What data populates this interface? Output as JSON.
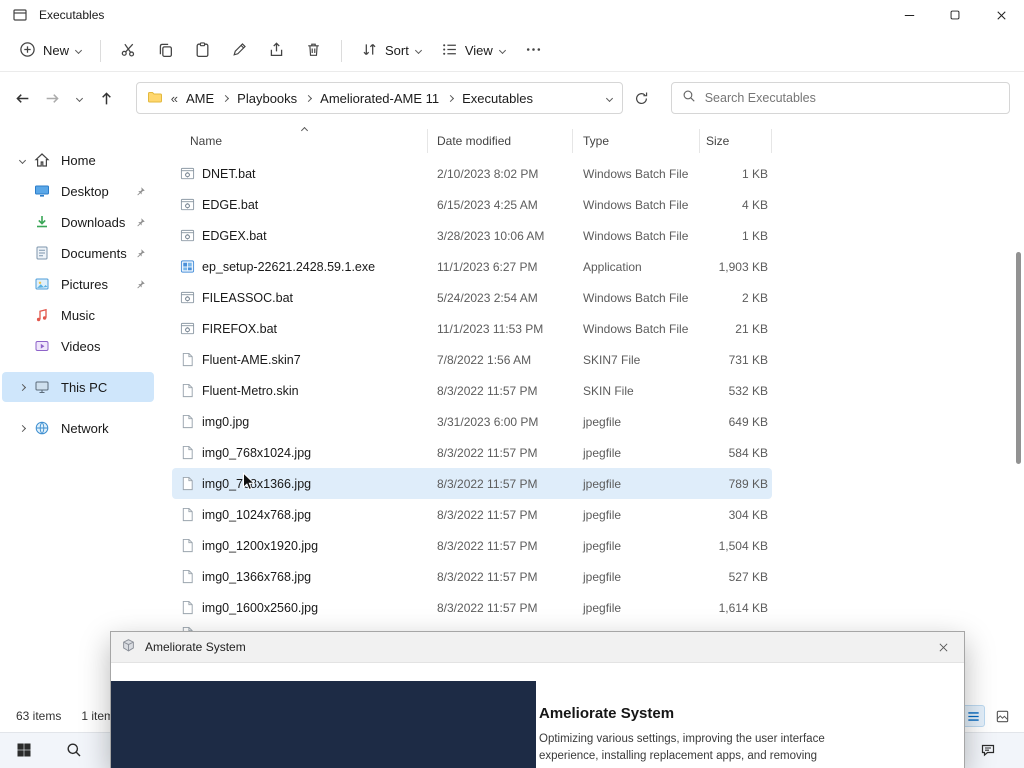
{
  "window": {
    "title": "Executables"
  },
  "toolbar": {
    "new": "New",
    "sort": "Sort",
    "view": "View"
  },
  "address": {
    "breadcrumb_prefix": "«",
    "crumbs": [
      "AME",
      "Playbooks",
      "Ameliorated-AME 11",
      "Executables"
    ],
    "search_placeholder": "Search Executables"
  },
  "sidebar": {
    "items": [
      {
        "label": "Home",
        "icon": "home-icon",
        "chevron": "down",
        "pinned": false,
        "selected": false,
        "gap_before": false
      },
      {
        "label": "Desktop",
        "icon": "desktop-icon",
        "chevron": null,
        "pinned": true,
        "selected": false,
        "gap_before": false
      },
      {
        "label": "Downloads",
        "icon": "downloads-icon",
        "chevron": null,
        "pinned": true,
        "selected": false,
        "gap_before": false
      },
      {
        "label": "Documents",
        "icon": "documents-icon",
        "chevron": null,
        "pinned": true,
        "selected": false,
        "gap_before": false
      },
      {
        "label": "Pictures",
        "icon": "pictures-icon",
        "chevron": null,
        "pinned": true,
        "selected": false,
        "gap_before": false
      },
      {
        "label": "Music",
        "icon": "music-icon",
        "chevron": null,
        "pinned": false,
        "selected": false,
        "gap_before": false
      },
      {
        "label": "Videos",
        "icon": "videos-icon",
        "chevron": null,
        "pinned": false,
        "selected": false,
        "gap_before": false
      },
      {
        "label": "This PC",
        "icon": "this-pc-icon",
        "chevron": "right",
        "pinned": false,
        "selected": true,
        "gap_before": true
      },
      {
        "label": "Network",
        "icon": "network-icon",
        "chevron": "right",
        "pinned": false,
        "selected": false,
        "gap_before": true
      }
    ]
  },
  "file_list": {
    "columns": [
      "Name",
      "Date modified",
      "Type",
      "Size"
    ],
    "sorted_column": "Name",
    "rows": [
      {
        "name": "DNET.bat",
        "date": "2/10/2023 8:02 PM",
        "type": "Windows Batch File",
        "size": "1 KB",
        "icon": "batch-file-icon",
        "hover": false
      },
      {
        "name": "EDGE.bat",
        "date": "6/15/2023 4:25 AM",
        "type": "Windows Batch File",
        "size": "4 KB",
        "icon": "batch-file-icon",
        "hover": false
      },
      {
        "name": "EDGEX.bat",
        "date": "3/28/2023 10:06 AM",
        "type": "Windows Batch File",
        "size": "1 KB",
        "icon": "batch-file-icon",
        "hover": false
      },
      {
        "name": "ep_setup-22621.2428.59.1.exe",
        "date": "11/1/2023 6:27 PM",
        "type": "Application",
        "size": "1,903 KB",
        "icon": "application-icon",
        "hover": false
      },
      {
        "name": "FILEASSOC.bat",
        "date": "5/24/2023 2:54 AM",
        "type": "Windows Batch File",
        "size": "2 KB",
        "icon": "batch-file-icon",
        "hover": false
      },
      {
        "name": "FIREFOX.bat",
        "date": "11/1/2023 11:53 PM",
        "type": "Windows Batch File",
        "size": "21 KB",
        "icon": "batch-file-icon",
        "hover": false
      },
      {
        "name": "Fluent-AME.skin7",
        "date": "7/8/2022 1:56 AM",
        "type": "SKIN7 File",
        "size": "731 KB",
        "icon": "file-icon",
        "hover": false
      },
      {
        "name": "Fluent-Metro.skin",
        "date": "8/3/2022 11:57 PM",
        "type": "SKIN File",
        "size": "532 KB",
        "icon": "file-icon",
        "hover": false
      },
      {
        "name": "img0.jpg",
        "date": "3/31/2023 6:00 PM",
        "type": "jpegfile",
        "size": "649 KB",
        "icon": "file-icon",
        "hover": false
      },
      {
        "name": "img0_768x1024.jpg",
        "date": "8/3/2022 11:57 PM",
        "type": "jpegfile",
        "size": "584 KB",
        "icon": "file-icon",
        "hover": false
      },
      {
        "name": "img0_768x1366.jpg",
        "date": "8/3/2022 11:57 PM",
        "type": "jpegfile",
        "size": "789 KB",
        "icon": "file-icon",
        "hover": true
      },
      {
        "name": "img0_1024x768.jpg",
        "date": "8/3/2022 11:57 PM",
        "type": "jpegfile",
        "size": "304 KB",
        "icon": "file-icon",
        "hover": false
      },
      {
        "name": "img0_1200x1920.jpg",
        "date": "8/3/2022 11:57 PM",
        "type": "jpegfile",
        "size": "1,504 KB",
        "icon": "file-icon",
        "hover": false
      },
      {
        "name": "img0_1366x768.jpg",
        "date": "8/3/2022 11:57 PM",
        "type": "jpegfile",
        "size": "527 KB",
        "icon": "file-icon",
        "hover": false
      },
      {
        "name": "img0_1600x2560.jpg",
        "date": "8/3/2022 11:57 PM",
        "type": "jpegfile",
        "size": "1,614 KB",
        "icon": "file-icon",
        "hover": false
      }
    ]
  },
  "status_bar": {
    "total": "63 items",
    "selected": "1 item"
  },
  "dialog": {
    "title": "Ameliorate System",
    "heading": "Ameliorate System",
    "body": "Optimizing various settings, improving the user interface experience, installing replacement apps, and removing"
  },
  "colors": {
    "accent": "#0067c0",
    "nav_selection": "#cfe6fb",
    "row_hover": "#dfedfa",
    "dialog_panel": "#1d2b45"
  }
}
